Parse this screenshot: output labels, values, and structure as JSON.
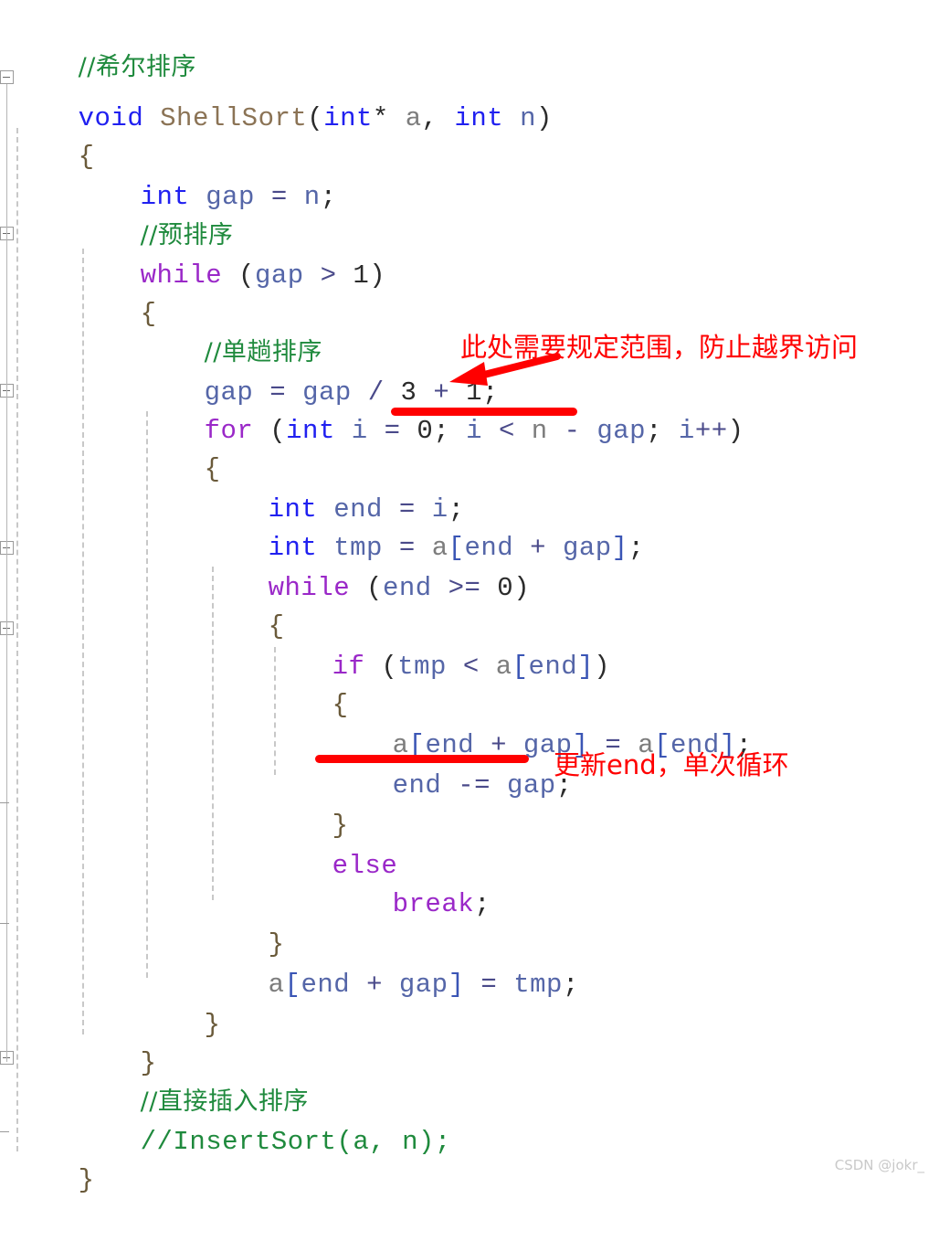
{
  "document": {
    "language": "C/C++",
    "watermark": "CSDN @jokr_"
  },
  "code": {
    "lines": [
      {
        "indent": 0,
        "text": "//希尔排序",
        "kind": "comment"
      },
      {
        "indent": 0,
        "text": "void ShellSort(int* a, int n)",
        "kind": "code"
      },
      {
        "indent": 0,
        "text": "{",
        "kind": "code"
      },
      {
        "indent": 1,
        "text": "int gap = n;",
        "kind": "code"
      },
      {
        "indent": 1,
        "text": "//预排序",
        "kind": "comment"
      },
      {
        "indent": 1,
        "text": "while (gap > 1)",
        "kind": "code"
      },
      {
        "indent": 1,
        "text": "{",
        "kind": "code"
      },
      {
        "indent": 2,
        "text": "//单趟排序",
        "kind": "comment"
      },
      {
        "indent": 2,
        "text": "gap = gap / 3 + 1;",
        "kind": "code"
      },
      {
        "indent": 2,
        "text": "for (int i = 0; i < n - gap; i++)",
        "kind": "code"
      },
      {
        "indent": 2,
        "text": "{",
        "kind": "code"
      },
      {
        "indent": 3,
        "text": "int end = i;",
        "kind": "code"
      },
      {
        "indent": 3,
        "text": "int tmp = a[end + gap];",
        "kind": "code"
      },
      {
        "indent": 3,
        "text": "while (end >= 0)",
        "kind": "code"
      },
      {
        "indent": 3,
        "text": "{",
        "kind": "code"
      },
      {
        "indent": 4,
        "text": "if (tmp < a[end])",
        "kind": "code"
      },
      {
        "indent": 4,
        "text": "{",
        "kind": "code"
      },
      {
        "indent": 5,
        "text": "a[end + gap] = a[end];",
        "kind": "code"
      },
      {
        "indent": 5,
        "text": "end -= gap;",
        "kind": "code"
      },
      {
        "indent": 4,
        "text": "}",
        "kind": "code"
      },
      {
        "indent": 4,
        "text": "else",
        "kind": "code"
      },
      {
        "indent": 5,
        "text": "break;",
        "kind": "code"
      },
      {
        "indent": 3,
        "text": "}",
        "kind": "code"
      },
      {
        "indent": 3,
        "text": "a[end + gap] = tmp;",
        "kind": "code"
      },
      {
        "indent": 2,
        "text": "}",
        "kind": "code"
      },
      {
        "indent": 1,
        "text": "}",
        "kind": "code"
      },
      {
        "indent": 1,
        "text": "//直接插入排序",
        "kind": "comment"
      },
      {
        "indent": 1,
        "text": "//InsertSort(a, n);",
        "kind": "comment"
      },
      {
        "indent": 0,
        "text": "}",
        "kind": "code"
      }
    ]
  },
  "annotations": [
    {
      "id": "range-note",
      "text": "此处需要规定范围，防止越界访问",
      "color": "#FF0000",
      "refers_to": "i < n - gap"
    },
    {
      "id": "end-note",
      "text": "更新end，单次循环",
      "color": "#FF0000",
      "refers_to": "end -= gap;"
    }
  ],
  "colors": {
    "background": "#FFFFFF",
    "keyword": "#9A28C8",
    "type": "#2020F0",
    "function": "#8B7355",
    "identifier": "#5566A8",
    "comment": "#1F8A3D",
    "annotation": "#FF0000",
    "indent_guide": "#C8C8C8",
    "watermark": "#C9C9C9"
  }
}
